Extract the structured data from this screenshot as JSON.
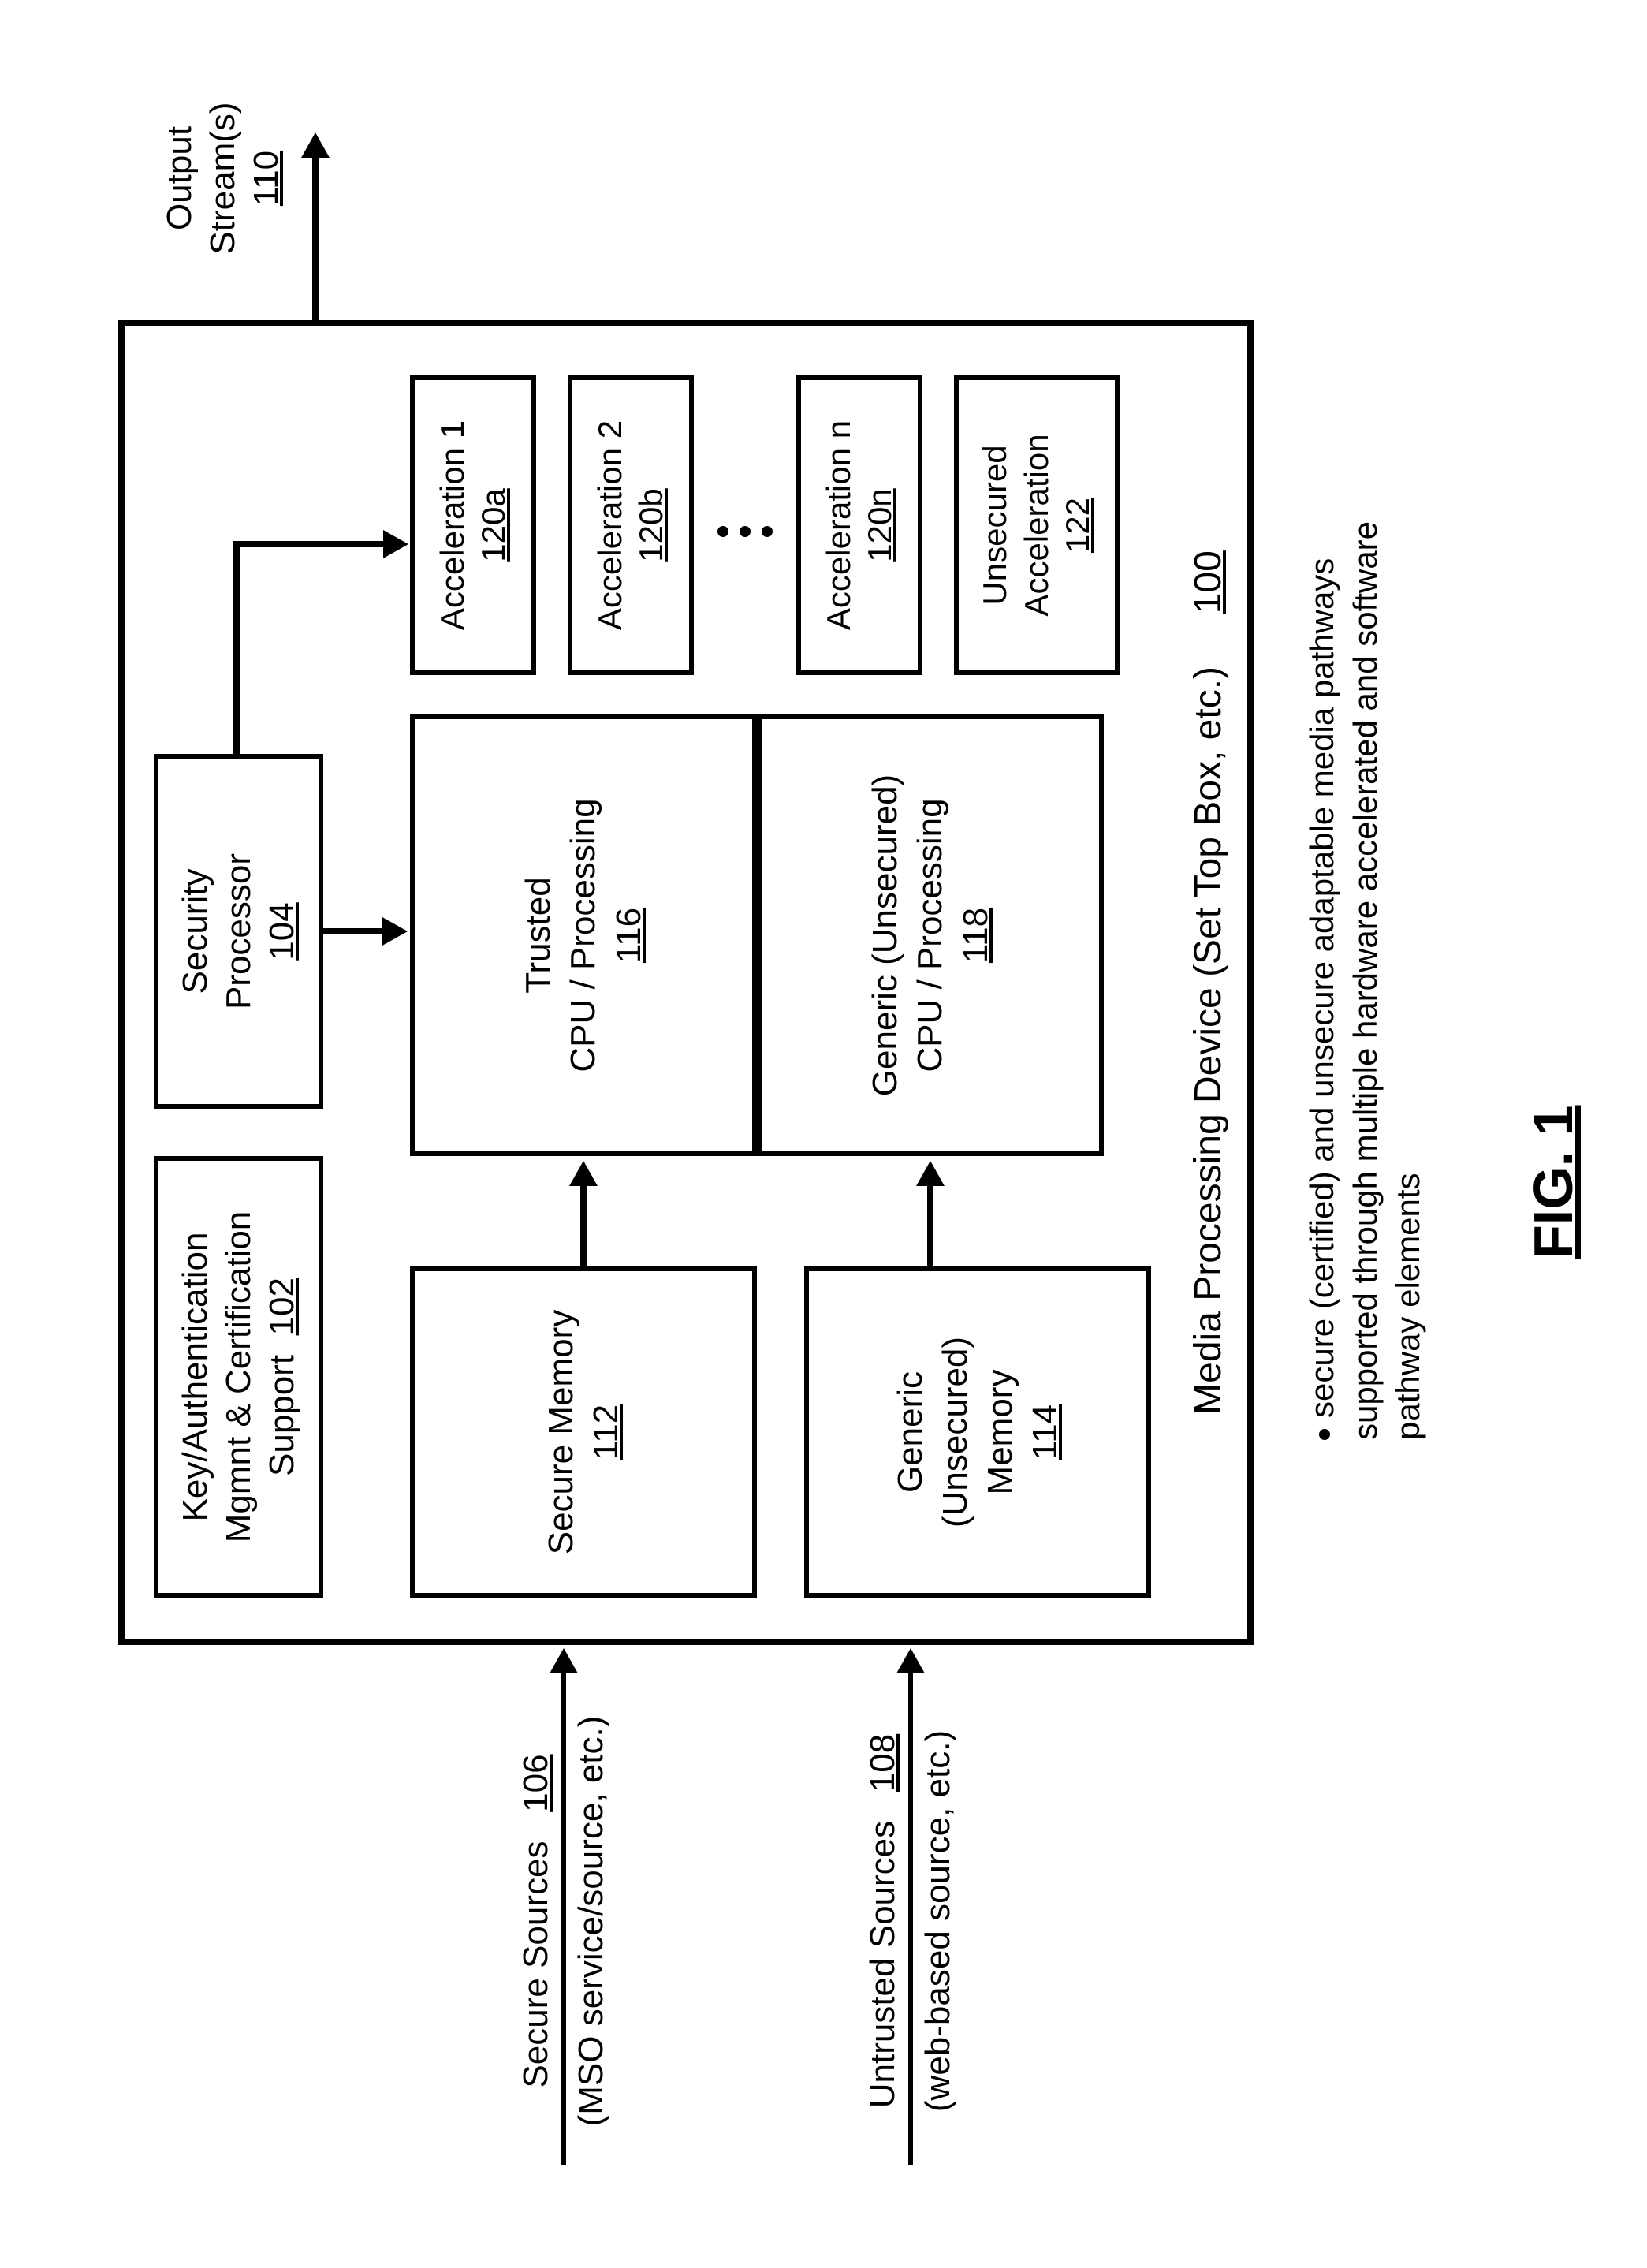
{
  "figure_label": "FIG. 1",
  "device": {
    "label": "Media Processing Device (Set Top Box, etc.)",
    "ref": "100"
  },
  "kamcs": {
    "line1": "Key/Authentication",
    "line2": "Mgmnt & Certification",
    "line3": "Support",
    "ref": "102"
  },
  "secproc": {
    "line1": "Security",
    "line2": "Processor",
    "ref": "104"
  },
  "secure_sources": {
    "label": "Secure Sources",
    "ref": "106",
    "sub": "(MSO service/source, etc.)"
  },
  "untrusted_sources": {
    "label": "Untrusted Sources",
    "ref": "108",
    "sub": "(web-based source, etc.)"
  },
  "output": {
    "line1": "Output",
    "line2": "Stream(s)",
    "ref": "110"
  },
  "secure_mem": {
    "line1": "Secure Memory",
    "ref": "112"
  },
  "generic_mem": {
    "line1": "Generic",
    "line2": "(Unsecured)",
    "line3": "Memory",
    "ref": "114"
  },
  "trusted_cpu": {
    "line1": "Trusted",
    "line2": "CPU / Processing",
    "ref": "116"
  },
  "generic_cpu": {
    "line1": "Generic (Unsecured)",
    "line2": "CPU / Processing",
    "ref": "118"
  },
  "accel1": {
    "label": "Acceleration 1",
    "ref": "120a"
  },
  "accel2": {
    "label": "Acceleration 2",
    "ref": "120b"
  },
  "acceln": {
    "label": "Acceleration n",
    "ref": "120n"
  },
  "unsec_accel": {
    "line1": "Unsecured",
    "line2": "Acceleration",
    "ref": "122"
  },
  "bullet": "secure (certified) and unsecure adaptable media pathways supported through multiple hardware accelerated and software pathway elements"
}
